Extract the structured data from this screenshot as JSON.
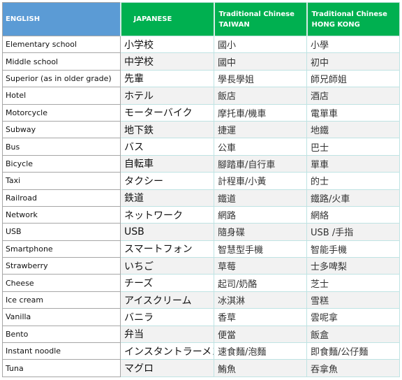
{
  "headers": {
    "english": "ENGLISH",
    "japanese": "JAPANESE",
    "taiwan_line1": "Traditional Chinese",
    "taiwan_line2": "TAIWAN",
    "hongkong_line1": "Traditional Chinese",
    "hongkong_line2": "HONG KONG"
  },
  "colors": {
    "english_header": "#5b9bd5",
    "other_headers": "#00b050",
    "alt_row": "#f2f2f2"
  },
  "rows": [
    [
      "Elementary school",
      "小学校",
      "國小",
      "小學"
    ],
    [
      "Middle school",
      "中学校",
      "國中",
      "初中"
    ],
    [
      "Superior (as in older grade)",
      "先輩",
      "學長學姐",
      "師兄師姐"
    ],
    [
      "Hotel",
      "ホテル",
      "飯店",
      "酒店"
    ],
    [
      "Motorcycle",
      "モーターバイク",
      "摩托車/機車",
      "電單車"
    ],
    [
      "Subway",
      "地下鉄",
      "捷運",
      "地鐵"
    ],
    [
      "Bus",
      "バス",
      "公車",
      "巴士"
    ],
    [
      "Bicycle",
      "自転車",
      "腳踏車/自行車",
      "單車"
    ],
    [
      "Taxi",
      "タクシー",
      "計程車/小黃",
      "的士"
    ],
    [
      "Railroad",
      "鉄道",
      "鐵道",
      "鐵路/火車"
    ],
    [
      "Network",
      "ネットワーク",
      "網路",
      "網絡"
    ],
    [
      "USB",
      "USB",
      "隨身碟",
      "USB /手指"
    ],
    [
      "Smartphone",
      "スマートフォン",
      "智慧型手機",
      "智能手機"
    ],
    [
      "Strawberry",
      "いちご",
      "草莓",
      "士多啤梨"
    ],
    [
      "Cheese",
      "チーズ",
      "起司/奶酪",
      "芝士"
    ],
    [
      "Ice cream",
      "アイスクリーム",
      "冰淇淋",
      "雪糕"
    ],
    [
      "Vanilla",
      "バニラ",
      "香草",
      "雲呢拿"
    ],
    [
      "Bento",
      "弁当",
      "便當",
      "飯盒"
    ],
    [
      "Instant noodle",
      "インスタントラーメン",
      "速食麵/泡麵",
      "即食麵/公仔麵"
    ],
    [
      "Tuna",
      "マグロ",
      "鮪魚",
      "吞拿魚"
    ]
  ]
}
